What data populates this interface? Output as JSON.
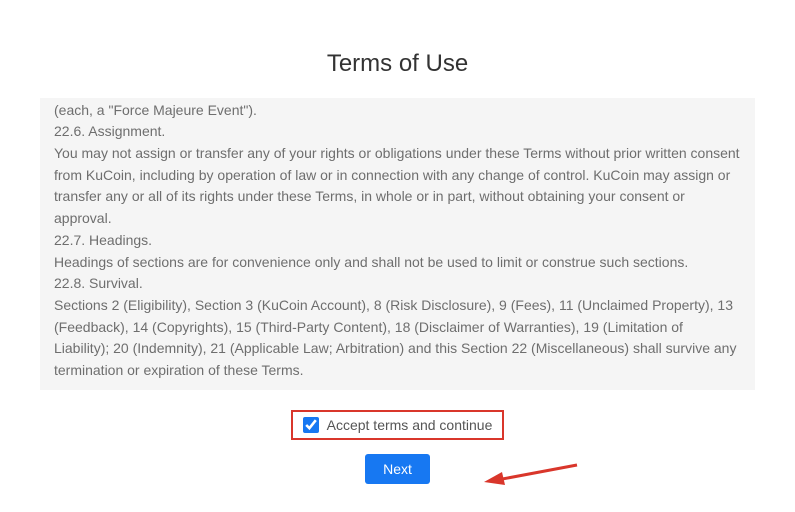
{
  "title": "Terms of Use",
  "terms": {
    "p1": "power failure, or equipment or software malfunction or any other cause beyond KuCoin's reasonable control (each, a \"Force Majeure Event\").",
    "s6title": "22.6. Assignment.",
    "s6body": "You may not assign or transfer any of your rights or obligations under these Terms without prior written consent from KuCoin, including by operation of law or in connection with any change of control. KuCoin may assign or transfer any or all of its rights under these Terms, in whole or in part, without obtaining your consent or approval.",
    "s7title": "22.7. Headings.",
    "s7body": "Headings of sections are for convenience only and shall not be used to limit or construe such sections.",
    "s8title": "22.8. Survival.",
    "s8body": "Sections 2 (Eligibility), Section 3 (KuCoin Account), 8 (Risk Disclosure), 9 (Fees), 11 (Unclaimed Property), 13 (Feedback), 14 (Copyrights), 15 (Third-Party Content), 18 (Disclaimer of Warranties), 19 (Limitation of Liability); 20 (Indemnity), 21 (Applicable Law; Arbitration) and this Section 22 (Miscellaneous) shall survive any termination or expiration of these Terms."
  },
  "checkbox": {
    "label": "Accept terms and continue",
    "checked": "checked"
  },
  "button": {
    "next": "Next"
  }
}
